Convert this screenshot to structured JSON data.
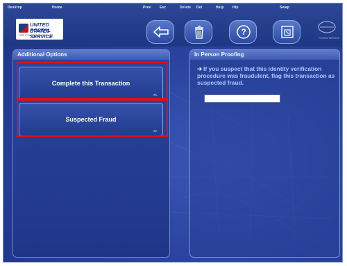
{
  "topbar": {
    "desktop_label": "Desktop",
    "home_label": "Home",
    "logo_line1": "UNITED STATES",
    "logo_line2": "POSTAL SERVICE",
    "logo_line3": "RSS POWERED BY NPOWER",
    "prev_label": "Prev",
    "prev_key": "Esc",
    "delete_label": "Delete",
    "delete_key": "Del",
    "help_label": "Help",
    "help_key": "Hlp",
    "swap_label": "Swap",
    "brand_right_text": "POSTAL SERVICE"
  },
  "left_panel": {
    "title": "Additional Options",
    "options": [
      {
        "label": "Complete this Transaction",
        "key": "F1"
      },
      {
        "label": "Suspected Fraud",
        "key": "F2"
      }
    ]
  },
  "right_panel": {
    "title": "In Person Proofing",
    "message": "If you suspect that this identity verification procedure was fraudulent, flag this transaction as suspected fraud.",
    "input_value": ""
  },
  "colors": {
    "highlight": "#e0101a",
    "message_text": "#a9c8ff"
  }
}
